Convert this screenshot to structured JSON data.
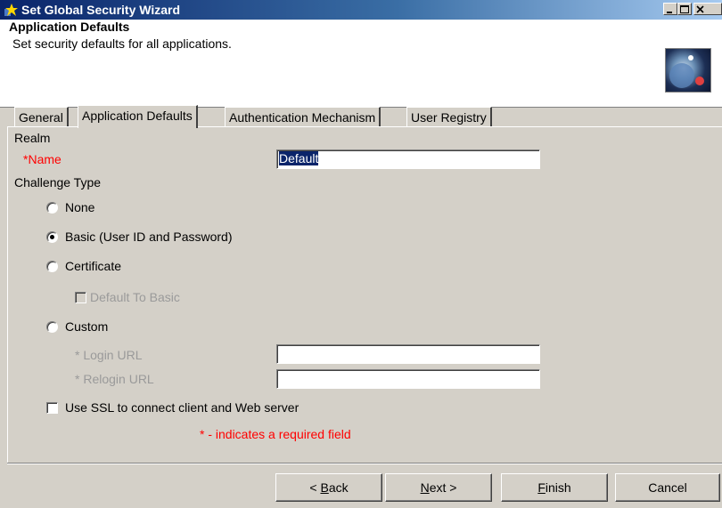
{
  "window": {
    "title": "Set Global Security Wizard",
    "controls": [
      "minimize-icon",
      "maximize-icon",
      "close-icon"
    ]
  },
  "header": {
    "title": "Application Defaults",
    "subtitle": "Set security defaults for all applications."
  },
  "tabs": [
    {
      "label": "General",
      "active": false
    },
    {
      "label": "Application Defaults",
      "active": true
    },
    {
      "label": "Authentication Mechanism",
      "active": false
    },
    {
      "label": "User Registry",
      "active": false
    }
  ],
  "form": {
    "realm_label": "Realm",
    "name_label": "Name",
    "required_marker": "*",
    "name_value": "Default",
    "challenge_label": "Challenge Type",
    "options": {
      "none": "None",
      "basic": "Basic (User ID and Password)",
      "certificate": "Certificate",
      "default_to_basic": "Default To Basic",
      "custom": "Custom"
    },
    "selected_challenge": "basic",
    "login_url_label": "* Login URL",
    "login_url_value": "",
    "relogin_url_label": "* Relogin URL",
    "relogin_url_value": "",
    "ssl_label": "Use SSL to connect client and Web server",
    "ssl_checked": false,
    "required_note": "* - indicates a required field"
  },
  "buttons": {
    "back": {
      "prefix": "< ",
      "mnemonic": "B",
      "rest": "ack"
    },
    "next": {
      "mnemonic": "N",
      "rest": "ext >"
    },
    "finish": {
      "mnemonic": "F",
      "rest": "inish"
    },
    "cancel": "Cancel"
  },
  "colors": {
    "titlebar_start": "#0a246a",
    "required": "#ff0000",
    "face": "#d4d0c8"
  }
}
